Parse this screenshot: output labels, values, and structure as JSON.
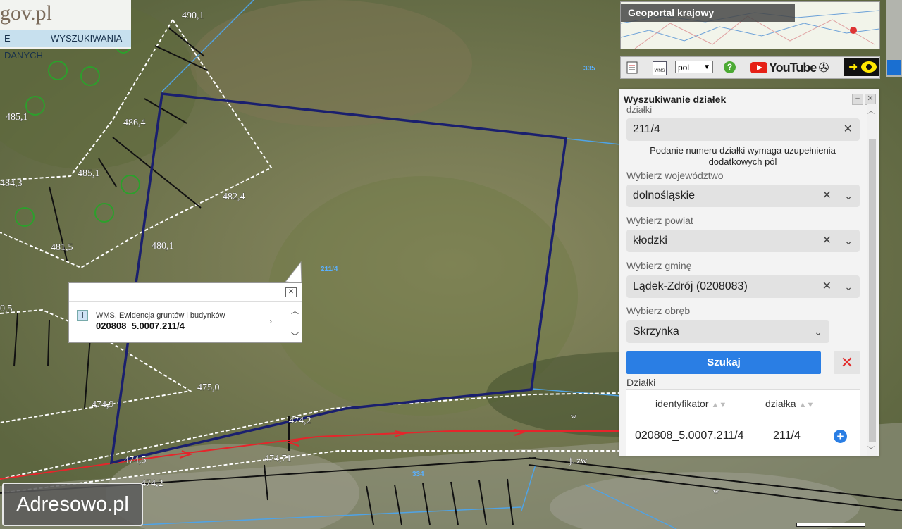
{
  "app": {
    "logo_text": "gov.pl"
  },
  "tabs": [
    {
      "label": "E DANYCH"
    },
    {
      "label": "WYSZUKIWANIA"
    }
  ],
  "geoportal": {
    "label": "Geoportal krajowy"
  },
  "toolbar": {
    "list_icon": "list-icon",
    "wms_icon": "wms-icon",
    "wms_text": "WMS",
    "language": "pol",
    "help": "?",
    "youtube": "YouTube",
    "accessibility_icon": "accessibility-icon",
    "eye_icon": "high-contrast-eye-icon"
  },
  "map": {
    "height_labels": [
      "490,1",
      "486,4",
      "485,1",
      "485,1",
      "484,3",
      "482,4",
      "481,5",
      "480,1",
      "0,5",
      "475,0",
      "474,9",
      "474,2",
      "474,71",
      "474,5",
      "474,2"
    ],
    "parcel_label": "211/4",
    "map_numbers": [
      "335",
      "334"
    ],
    "road_marks": [
      "w",
      "w",
      "j. zw"
    ]
  },
  "popup": {
    "layer": "WMS, Ewidencja gruntów i budynków",
    "identifier": "020808_5.0007.211/4"
  },
  "search_panel": {
    "title": "Wyszukiwanie działek",
    "parcel_label": "działki",
    "parcel_value": "211/4",
    "note": "Podanie numeru działki wymaga uzupełnienia dodatkowych pól",
    "voivodeship": {
      "label": "Wybierz województwo",
      "value": "dolnośląskie"
    },
    "county": {
      "label": "Wybierz powiat",
      "value": "kłodzki"
    },
    "commune": {
      "label": "Wybierz gminę",
      "value": "Lądek-Zdrój (0208083)"
    },
    "precinct": {
      "label": "Wybierz obręb",
      "value": "Skrzynka"
    },
    "search_button": "Szukaj",
    "results_label": "Działki",
    "columns": [
      "identyfikator",
      "działka"
    ],
    "rows": [
      {
        "identyfikator": "020808_5.0007.211/4",
        "dzialka": "211/4"
      }
    ]
  },
  "watermark": "Adresowo.pl",
  "colors": {
    "parcel_outline": "#1a1f6e",
    "primary_button": "#2a7ee4",
    "clear_icon": "#e22a2a",
    "road_line": "#e5252b"
  }
}
